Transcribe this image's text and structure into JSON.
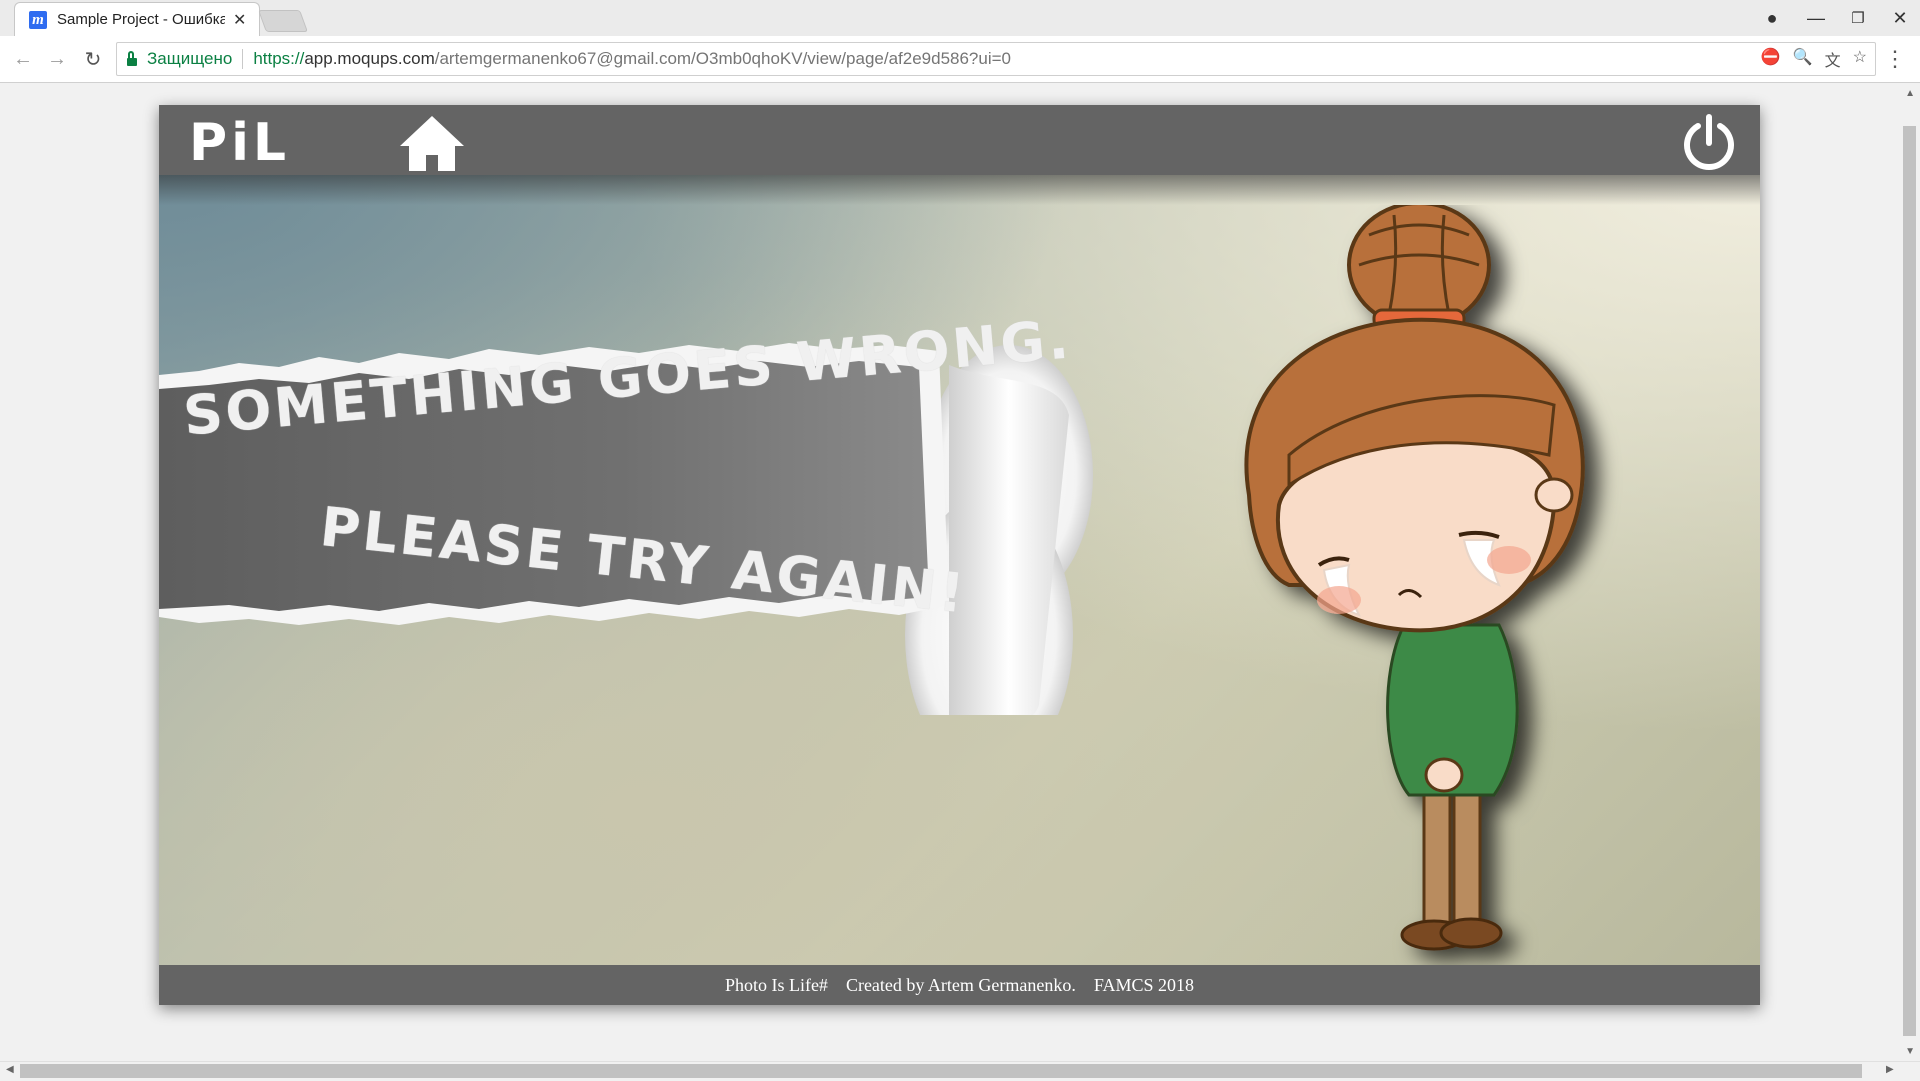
{
  "browser": {
    "tab_title": "Sample Project - Ошибка",
    "favicon_letter": "m",
    "secure_label": "Защищено",
    "url_scheme": "https://",
    "url_host": "app.moqups.com",
    "url_path": "/artemgermanenko67@gmail.com/O3mb0qhoKV/view/page/af2e9d586?ui=0"
  },
  "app": {
    "logo_text": "PiL",
    "error_line1": "SOMETHING GOES WRONG.",
    "error_line2": "PLEASE TRY AGAIN!",
    "footer": {
      "brand": "Photo Is Life#",
      "credit": "Created by Artem Germanenko.",
      "org": "FAMCS 2018"
    },
    "header_color": "#646464"
  },
  "icons": [
    "home-icon",
    "power-icon",
    "back-icon",
    "forward-icon",
    "reload-icon",
    "lock-icon",
    "star-icon",
    "translate-icon",
    "zoom-icon",
    "menu-icon"
  ]
}
